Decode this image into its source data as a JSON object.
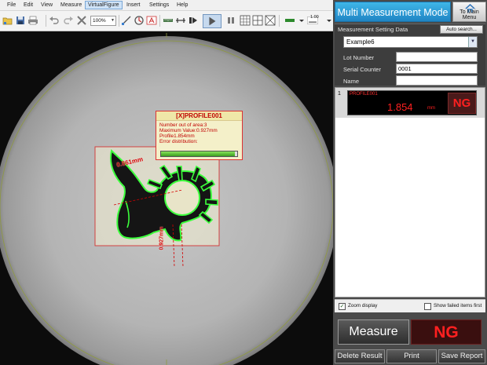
{
  "menu": {
    "items": [
      "File",
      "Edit",
      "View",
      "Measure",
      "VirtualFigure",
      "Insert",
      "Settings",
      "Help"
    ],
    "active": "VirtualFigure"
  },
  "toolbar": {
    "zoom": "100%",
    "line_width": "1.00",
    "icons": [
      "open-folder-icon",
      "save-icon",
      "print-icon",
      "undo-icon",
      "redo-icon",
      "delete-icon",
      "zoom-select",
      "measure-tool-icon",
      "settings-tool-icon",
      "text-tool-icon",
      "ruler-icon",
      "edge-tool-icon",
      "play-icon",
      "step-icon",
      "grid-icon",
      "crosshair-icon",
      "fill-color-icon",
      "line-width-select"
    ]
  },
  "viewer": {
    "info_box": {
      "title_prefix": "[X]",
      "title": "PROFILE001",
      "lines": [
        "Number out of area:3",
        "Maximum Value:0.927mm",
        "Profile1.854mm",
        "Error distribution:"
      ],
      "error_distribution": 0.97
    },
    "dimension_labels": [
      "0.861mm",
      "0.927mm"
    ]
  },
  "panel": {
    "mode_title": "Multi Measurement Mode",
    "main_menu_label": "To Main Menu",
    "setting_data_label": "Measurement Setting Data",
    "auto_search_label": "Auto search...",
    "setting_value": "Example6",
    "fields": [
      {
        "label": "Lot Number",
        "value": ""
      },
      {
        "label": "Serial Counter",
        "value": "0001"
      },
      {
        "label": "Name",
        "value": ""
      }
    ],
    "results": [
      {
        "index": "1",
        "name": "PROFILE001",
        "value": "1.854",
        "unit": "mm",
        "status": "NG"
      }
    ],
    "zoom_display_label": "Zoom display",
    "zoom_display_checked": true,
    "show_failed_label": "Show failed items first",
    "show_failed_checked": false,
    "measure_label": "Measure",
    "overall_status": "NG",
    "delete_label": "Delete Result",
    "print_label": "Print",
    "save_label": "Save Report"
  },
  "colors": {
    "accent": "#2a9ad6",
    "ng_red": "#ff2020",
    "profile_green": "#3cff3c",
    "roi_red": "#d33333"
  }
}
